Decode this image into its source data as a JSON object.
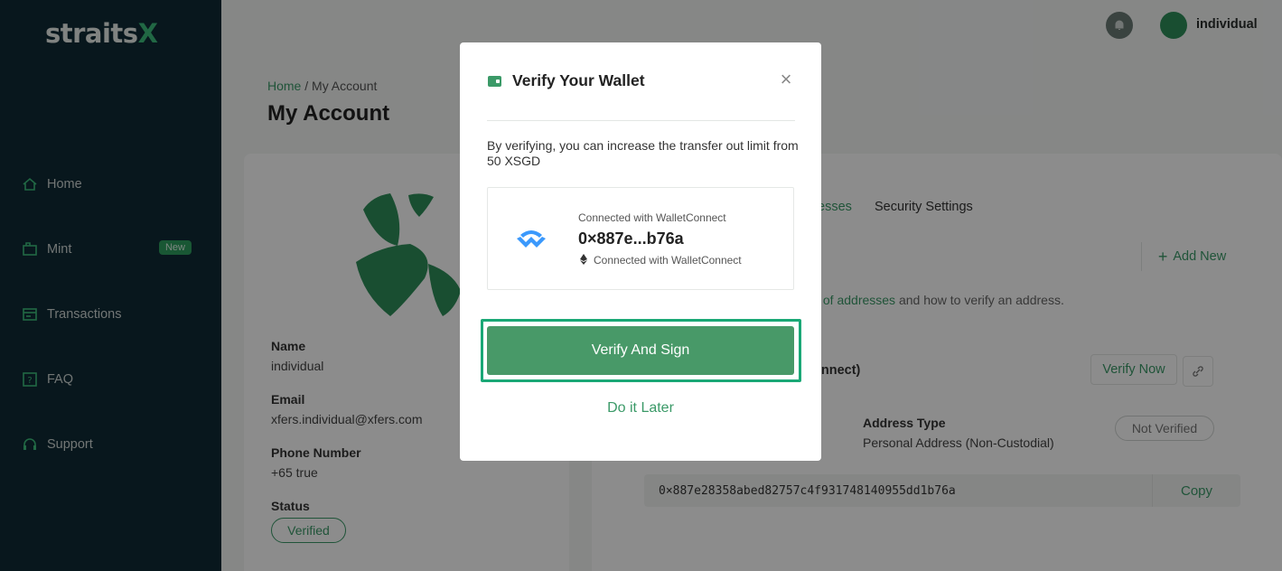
{
  "app": {
    "logo_main": "straits",
    "logo_accent": "X"
  },
  "sidebar": {
    "items": [
      {
        "label": "Home",
        "icon": "home-icon"
      },
      {
        "label": "Mint",
        "icon": "mint-icon",
        "badge": "New"
      },
      {
        "label": "Transactions",
        "icon": "transactions-icon"
      },
      {
        "label": "FAQ",
        "icon": "faq-icon"
      },
      {
        "label": "Support",
        "icon": "headset-icon"
      }
    ]
  },
  "header": {
    "username": "individual"
  },
  "page": {
    "breadcrumb_home": "Home",
    "breadcrumb_sep": " / ",
    "breadcrumb_current": "My Account",
    "title": "My Account"
  },
  "profile": {
    "name_label": "Name",
    "name_value": "individual",
    "email_label": "Email",
    "email_value": "xfers.individual@xfers.com",
    "phone_label": "Phone Number",
    "phone_value": "+65 true",
    "status_label": "Status",
    "status_value": "Verified"
  },
  "addresses": {
    "tab_partial": "esses",
    "tab_security": "Security Settings",
    "add_new": "Add New",
    "help_link": "s of addresses",
    "help_text": " and how to verify an address.",
    "wallet_title": "onnect)",
    "verify_now": "Verify Now",
    "address_type_label": "Address Type",
    "address_type_value": "Personal Address (Non-Custodial)",
    "status": "Not Verified",
    "full_address": "0×887e28358abed82757c4f931748140955dd1b76a",
    "copy": "Copy"
  },
  "modal": {
    "title": "Verify Your Wallet",
    "close": "×",
    "description": "By verifying, you can increase the transfer out limit from 50 XSGD",
    "connected_top": "Connected with WalletConnect",
    "address_short": "0×887e...b76a",
    "connected_bottom": "Connected with WalletConnect",
    "verify_button": "Verify And Sign",
    "later_button": "Do it Later"
  },
  "colors": {
    "brand_green": "#3b9a68",
    "sidebar_bg": "#0f2a35",
    "highlight": "#1aa876"
  }
}
